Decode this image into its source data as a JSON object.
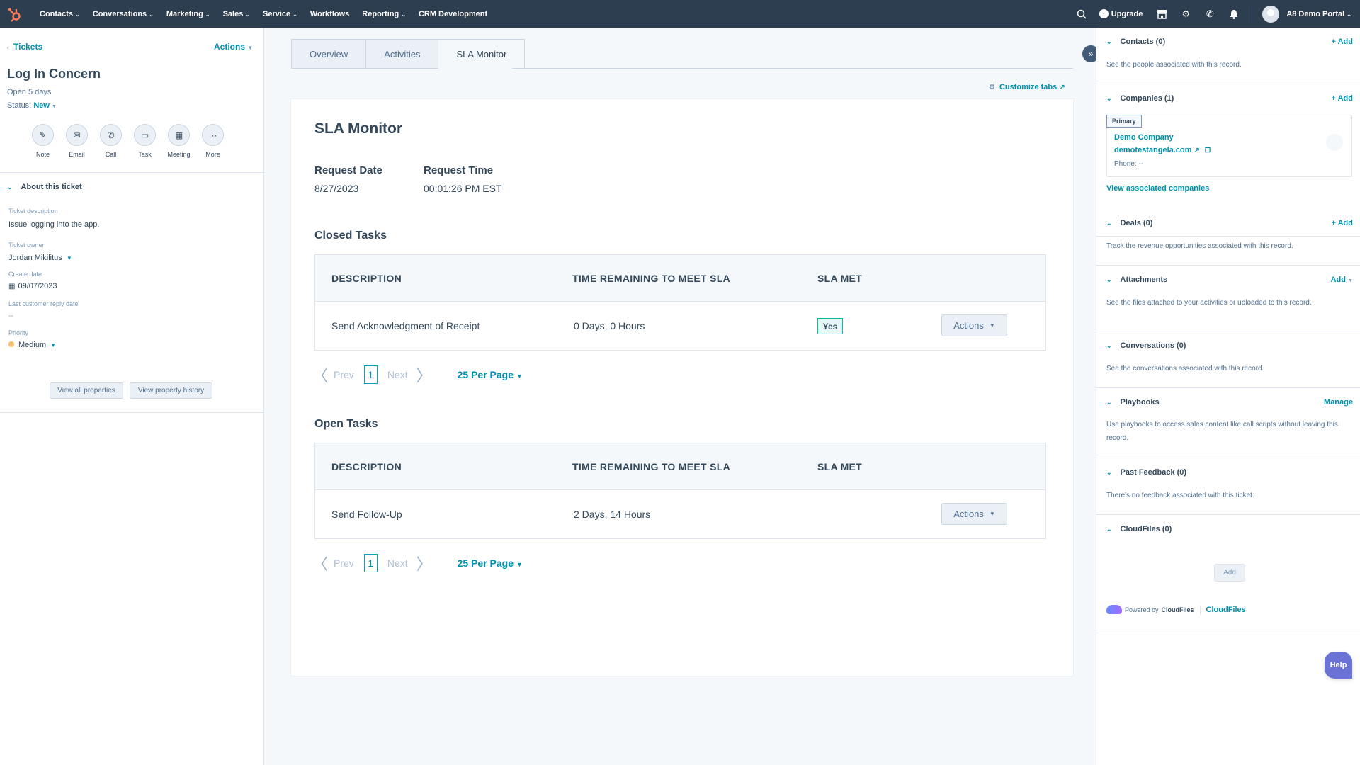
{
  "topnav": {
    "items": [
      {
        "label": "Contacts",
        "dropdown": true
      },
      {
        "label": "Conversations",
        "dropdown": true
      },
      {
        "label": "Marketing",
        "dropdown": true
      },
      {
        "label": "Sales",
        "dropdown": true
      },
      {
        "label": "Service",
        "dropdown": true
      },
      {
        "label": "Workflows",
        "dropdown": false
      },
      {
        "label": "Reporting",
        "dropdown": true
      },
      {
        "label": "CRM Development",
        "dropdown": false
      }
    ],
    "upgrade": "Upgrade",
    "portal": "A8 Demo Portal",
    "icons": [
      "search-icon",
      "upgrade-icon",
      "marketplace-icon",
      "settings-icon",
      "calling-icon",
      "notifications-icon"
    ]
  },
  "left": {
    "back": "Tickets",
    "actions": "Actions",
    "title": "Log In Concern",
    "open_days": "Open 5 days",
    "status_label": "Status:",
    "status_value": "New",
    "activity_buttons": [
      "Note",
      "Email",
      "Call",
      "Task",
      "Meeting",
      "More"
    ],
    "about_title": "About this ticket",
    "properties": {
      "description_label": "Ticket description",
      "description_value": "Issue logging into the app.",
      "owner_label": "Ticket owner",
      "owner_value": "Jordan Mikilitus",
      "create_label": "Create date",
      "create_value": "09/07/2023",
      "reply_label": "Last customer reply date",
      "reply_value": "--",
      "priority_label": "Priority",
      "priority_value": "Medium"
    },
    "view_all": "View all properties",
    "view_history": "View property history"
  },
  "center": {
    "tabs": [
      "Overview",
      "Activities",
      "SLA Monitor"
    ],
    "active_tab": "SLA Monitor",
    "customize": "Customize tabs",
    "title": "SLA Monitor",
    "request_date_label": "Request Date",
    "request_date": "8/27/2023",
    "request_time_label": "Request Time",
    "request_time": "00:01:26 PM EST",
    "columns": [
      "DESCRIPTION",
      "TIME REMAINING TO MEET SLA",
      "SLA MET"
    ],
    "closed": {
      "title": "Closed Tasks",
      "rows": [
        {
          "description": "Send Acknowledgment of Receipt",
          "remaining": "0 Days, 0 Hours",
          "met": "Yes",
          "action": "Actions"
        }
      ]
    },
    "open": {
      "title": "Open Tasks",
      "rows": [
        {
          "description": "Send Follow-Up",
          "remaining": "2 Days, 14 Hours",
          "met": "",
          "action": "Actions"
        }
      ]
    },
    "pager": {
      "prev": "Prev",
      "page": "1",
      "next": "Next",
      "per_page": "25 Per Page"
    }
  },
  "right": {
    "contacts": {
      "title": "Contacts (0)",
      "add": "+ Add",
      "desc": "See the people associated with this record."
    },
    "companies": {
      "title": "Companies (1)",
      "add": "+ Add",
      "badge": "Primary",
      "name": "Demo Company",
      "domain": "demotestangela.com",
      "phone": "Phone: --",
      "view": "View associated companies"
    },
    "deals": {
      "title": "Deals (0)",
      "add": "+ Add",
      "desc": "Track the revenue opportunities associated with this record."
    },
    "attachments": {
      "title": "Attachments",
      "add": "Add",
      "desc": "See the files attached to your activities or uploaded to this record."
    },
    "conversations": {
      "title": "Conversations (0)",
      "desc": "See the conversations associated with this record."
    },
    "playbooks": {
      "title": "Playbooks",
      "manage": "Manage",
      "desc": "Use playbooks to access sales content like call scripts without leaving this record."
    },
    "feedback": {
      "title": "Past Feedback (0)",
      "desc": "There's no feedback associated with this ticket."
    },
    "cloudfiles": {
      "title": "CloudFiles (0)",
      "add": "Add",
      "powered": "Powered by",
      "powered_brand": "CloudFiles",
      "link": "CloudFiles"
    }
  },
  "help": "Help"
}
